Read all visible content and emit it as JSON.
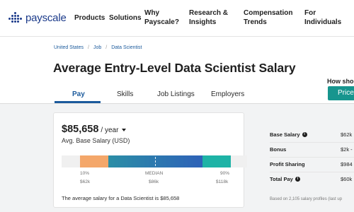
{
  "header": {
    "logo_text": "payscale",
    "nav": [
      {
        "line1": "Products",
        "line2": ""
      },
      {
        "line1": "Solutions",
        "line2": ""
      },
      {
        "line1": "Why",
        "line2": "Payscale?"
      },
      {
        "line1": "Research &",
        "line2": "Insights"
      },
      {
        "line1": "Compensation",
        "line2": "Trends"
      },
      {
        "line1": "For",
        "line2": "Individuals"
      }
    ]
  },
  "breadcrumb": [
    "United States",
    "Job",
    "Data Scientist"
  ],
  "page_title": "Average Entry-Level Data Scientist Salary",
  "tabs": [
    "Pay",
    "Skills",
    "Job Listings",
    "Employers"
  ],
  "cta": {
    "prompt": "How sho",
    "button": "Price"
  },
  "summary": {
    "amount": "$85,658",
    "period": "/ year",
    "label": "Avg. Base Salary (USD)",
    "percentiles": {
      "p10_label": "10%",
      "p10_value": "$62k",
      "median_label": "MEDIAN",
      "median_value": "$86k",
      "p90_label": "90%",
      "p90_value": "$118k"
    },
    "bar_colors": {
      "low": "#f4a76a",
      "mid_start": "#2b8ea6",
      "mid_end": "#2e62b8",
      "high": "#1eb3a6"
    },
    "footnote": "The average salary for a Data Scientist is $85,658"
  },
  "breakdown": [
    {
      "label": "Base Salary",
      "has_info": true,
      "value": "$62k"
    },
    {
      "label": "Bonus",
      "has_info": false,
      "value": "$2k -"
    },
    {
      "label": "Profit Sharing",
      "has_info": false,
      "value": "$984"
    },
    {
      "label": "Total Pay",
      "has_info": true,
      "value": "$60k"
    }
  ],
  "based_on": "Based on 2,105 salary profiles (last up"
}
